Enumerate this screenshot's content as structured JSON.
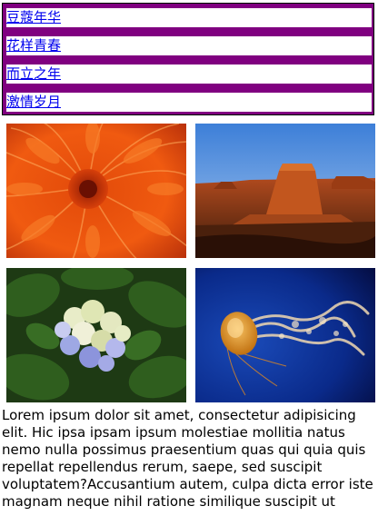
{
  "nav": {
    "items": [
      {
        "label": "豆蔻年华"
      },
      {
        "label": "花样青春"
      },
      {
        "label": "而立之年"
      },
      {
        "label": "激情岁月"
      }
    ],
    "background_color": "#800080",
    "link_color": "#0000ee"
  },
  "gallery": {
    "images": [
      {
        "name": "orange-chrysanthemum-image"
      },
      {
        "name": "desert-butte-image"
      },
      {
        "name": "hydrangea-image"
      },
      {
        "name": "jellyfish-image"
      }
    ]
  },
  "content": {
    "text": "Lorem ipsum dolor sit amet, consectetur adipisicing elit. Hic ipsa ipsam ipsum molestiae mollitia natus nemo nulla possimus praesentium quas qui quia quis repellat repellendus rerum, saepe, sed suscipit voluptatem?Accusantium autem, culpa dicta error iste magnam neque nihil ratione similique suscipit ut"
  }
}
